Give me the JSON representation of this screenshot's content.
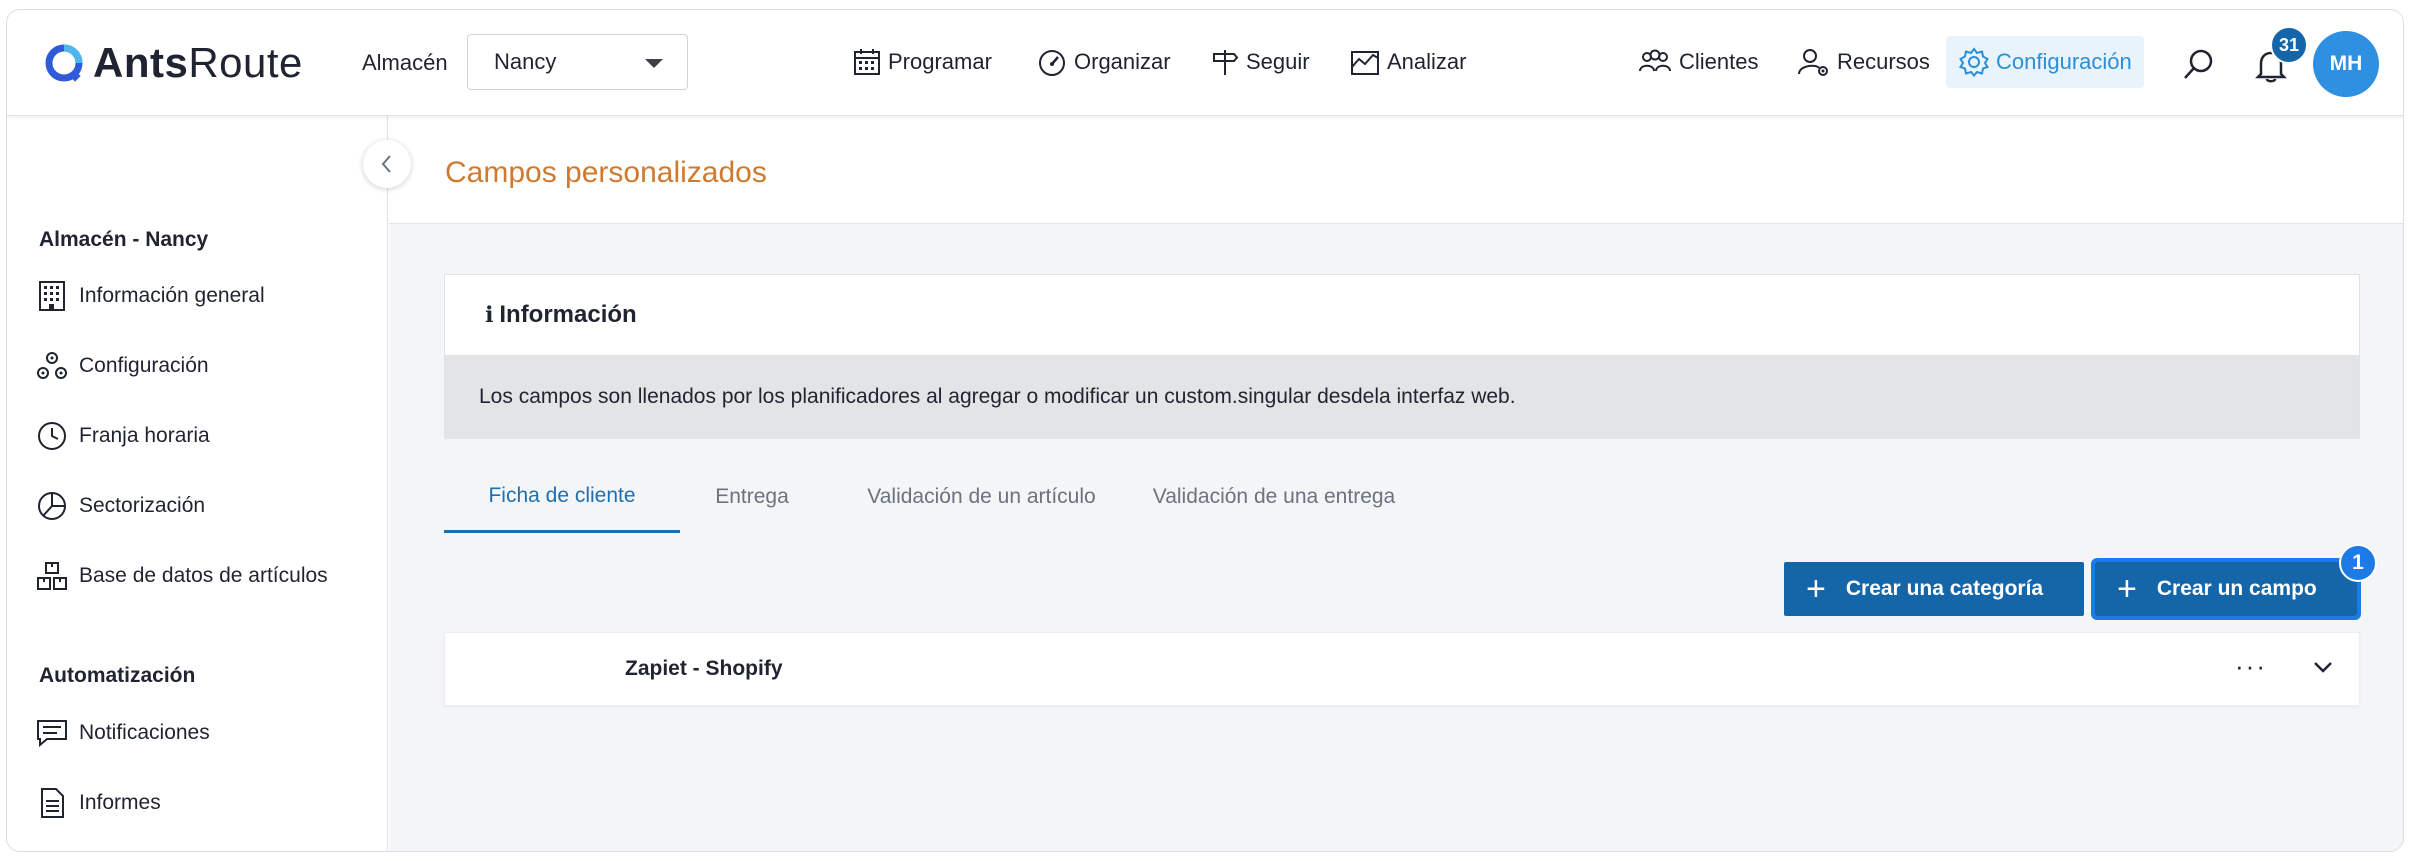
{
  "app": {
    "logo_bold": "Ants",
    "logo_light": "Route"
  },
  "header": {
    "warehouse_label": "Almacén",
    "warehouse_value": "Nancy",
    "nav": [
      {
        "label": "Programar",
        "icon": "calendar-icon"
      },
      {
        "label": "Organizar",
        "icon": "speedometer-icon"
      },
      {
        "label": "Seguir",
        "icon": "signpost-icon"
      },
      {
        "label": "Analizar",
        "icon": "chart-icon"
      }
    ],
    "right_nav": [
      {
        "label": "Clientes",
        "icon": "people-icon"
      },
      {
        "label": "Recursos",
        "icon": "user-gear-icon"
      },
      {
        "label": "Configuración",
        "icon": "gear-icon"
      }
    ],
    "notification_count": "31",
    "avatar_initials": "MH",
    "accent_color": "#2c8fd6"
  },
  "sidebar": {
    "section1_title": "Almacén - Nancy",
    "items": [
      {
        "label": "Información general",
        "icon": "building-icon"
      },
      {
        "label": "Configuración",
        "icon": "gears-icon"
      },
      {
        "label": "Franja horaria",
        "icon": "clock-icon"
      },
      {
        "label": "Sectorización",
        "icon": "pie-icon"
      },
      {
        "label": "Base de datos de artículos",
        "icon": "boxes-icon"
      }
    ],
    "section2_title": "Automatización",
    "items2": [
      {
        "label": "Notificaciones",
        "icon": "message-icon"
      },
      {
        "label": "Informes",
        "icon": "document-icon"
      }
    ]
  },
  "main": {
    "page_title": "Campos personalizados",
    "info_title": "Información",
    "info_text": "Los campos son llenados por los planificadores al agregar o modificar un custom.singular desdela interfaz web.",
    "tabs": [
      {
        "label": "Ficha de cliente",
        "active": true
      },
      {
        "label": "Entrega",
        "active": false
      },
      {
        "label": "Validación de un artículo",
        "active": false
      },
      {
        "label": "Validación de una entrega",
        "active": false
      }
    ],
    "create_category_label": "Crear una categoría",
    "create_field_label": "Crear un campo",
    "step_badge": "1",
    "categories": [
      {
        "name": "Zapiet - Shopify"
      }
    ]
  }
}
